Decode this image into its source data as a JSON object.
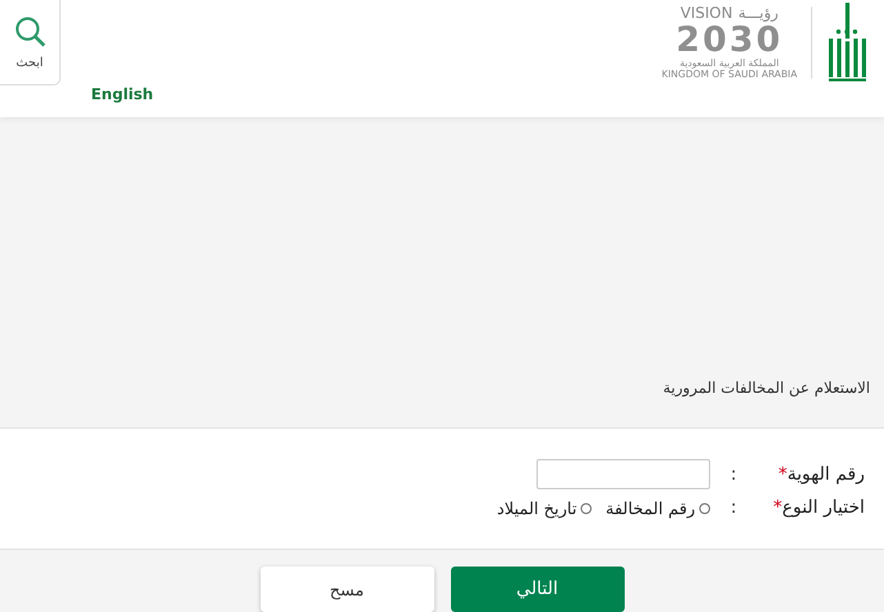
{
  "header": {
    "vision": {
      "word_ar": "رؤيـــة",
      "word_en": "VISION",
      "year": "2030",
      "kingdom_ar": "المملكة العربية السعودية",
      "kingdom_en": "KINGDOM OF SAUDI ARABIA"
    },
    "search_button": "ابحث",
    "language_link": "English"
  },
  "page_title": "الاستعلام عن المخالفات المرورية",
  "form": {
    "id_field": {
      "label": "رقم الهوية",
      "required_mark": "*",
      "colon": ":"
    },
    "type_field": {
      "label": "اختيار النوع",
      "required_mark": "*",
      "colon": ":",
      "options": [
        {
          "label": "رقم المخالفة",
          "selected": false
        },
        {
          "label": "تاريخ الميلاد",
          "selected": false
        }
      ]
    }
  },
  "buttons": {
    "next": "التالي",
    "clear": "مسح"
  }
}
